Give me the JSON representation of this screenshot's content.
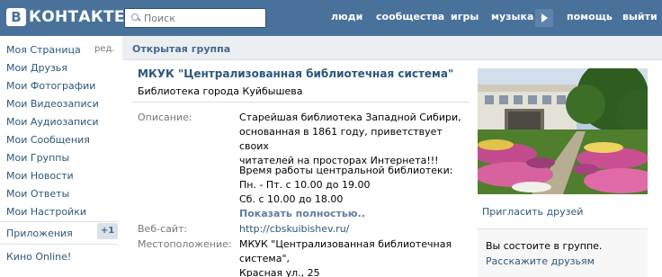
{
  "header": {
    "logo_letter": "В",
    "logo_text": "КОНТАКТЕ",
    "search_placeholder": "Поиск",
    "nav": [
      "люди",
      "сообщества",
      "игры",
      "музыка",
      "помощь",
      "выйти"
    ]
  },
  "sidebar": {
    "edit_label": "ред.",
    "items": [
      "Моя Страница",
      "Мои Друзья",
      "Мои Фотографии",
      "Мои Видеозаписи",
      "Мои Аудиозаписи",
      "Мои Сообщения",
      "Мои Группы",
      "Мои Новости",
      "Мои Ответы",
      "Мои Настройки"
    ],
    "apps_label": "Приложения",
    "apps_badge": "+1",
    "extra_item": "Кино Online!"
  },
  "main": {
    "section_title": "Открытая группа",
    "group_name": "МКУК \"Централизованная библиотечная система\"",
    "group_status": "Библиотека города Куйбышева",
    "description_label": "Описание:",
    "description_lines": [
      "Старейшая библиотека Западной Сибири,",
      "основанная в 1861 году, приветствует своих",
      "читателей на просторах Интернета!!!"
    ],
    "hours_lines": [
      "Время работы центральной библиотеки:",
      "Пн. - Пт. с 10.00 до 19.00",
      "Сб. с 10.00 до 18.00"
    ],
    "show_more": "Показать полностью..",
    "website_label": "Веб-сайт:",
    "website": "http://cbskuibishev.ru/",
    "location_label": "Местоположение:",
    "location_lines": [
      "МКУК \"Централизованная библиотечная система\",",
      "Красная ул., 25"
    ]
  },
  "right": {
    "invite": "Пригласить друзей",
    "member_text": "Вы состоите в группе.",
    "member_tell": "Расскажите друзьям"
  },
  "colors": {
    "header_bg": "#49729b",
    "link": "#2b587a",
    "label_gray": "#777777",
    "section_bg": "#ebeff2"
  }
}
